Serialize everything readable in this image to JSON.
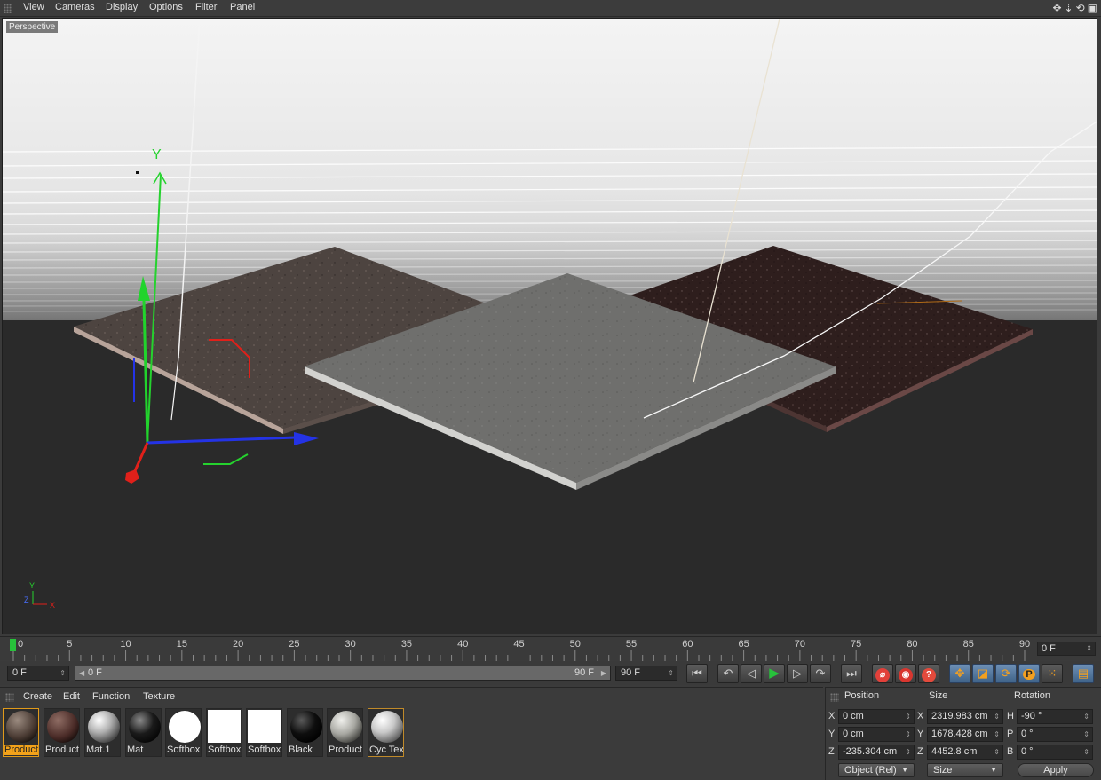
{
  "menubar": {
    "items": [
      "View",
      "Cameras",
      "Display",
      "Options",
      "Filter",
      "Panel"
    ]
  },
  "viewport": {
    "label": "Perspective",
    "axis_labels": {
      "y_gizmo": "Y",
      "mini_y": "Y",
      "mini_z": "Z",
      "mini_x": "X"
    }
  },
  "timeline": {
    "ticks": [
      "0",
      "5",
      "10",
      "15",
      "20",
      "25",
      "30",
      "35",
      "40",
      "45",
      "50",
      "55",
      "60",
      "65",
      "70",
      "75",
      "80",
      "85",
      "90"
    ],
    "current_frame": "0 F"
  },
  "transport": {
    "start_field": "0 F",
    "range_start": "0 F",
    "range_end": "90 F",
    "end_field": "90 F"
  },
  "materials": {
    "menu": [
      "Create",
      "Edit",
      "Function",
      "Texture"
    ],
    "items": [
      {
        "label": "Product"
      },
      {
        "label": "Product"
      },
      {
        "label": "Mat.1"
      },
      {
        "label": "Mat"
      },
      {
        "label": "Softbox"
      },
      {
        "label": "Softbox"
      },
      {
        "label": "Softbox"
      },
      {
        "label": "Black"
      },
      {
        "label": "Product"
      },
      {
        "label": "Cyc Tex"
      }
    ]
  },
  "coordinates": {
    "headers": {
      "position": "Position",
      "size": "Size",
      "rotation": "Rotation"
    },
    "rows": [
      {
        "axis": "X",
        "pos": "0 cm",
        "size_axis": "X",
        "size": "2319.983 cm",
        "rot_axis": "H",
        "rot": "-90 °"
      },
      {
        "axis": "Y",
        "pos": "0 cm",
        "size_axis": "Y",
        "size": "1678.428 cm",
        "rot_axis": "P",
        "rot": "0 °"
      },
      {
        "axis": "Z",
        "pos": "-235.304 cm",
        "size_axis": "Z",
        "size": "4452.8 cm",
        "rot_axis": "B",
        "rot": "0 °"
      }
    ],
    "mode_dropdown": "Object (Rel)",
    "size_dropdown": "Size",
    "apply_label": "Apply"
  },
  "colors": {
    "selection": "#f2a21a",
    "play_green": "#27c23b",
    "axis_x": "#e0201a",
    "axis_y": "#1fd32a",
    "axis_z": "#2433e6"
  }
}
